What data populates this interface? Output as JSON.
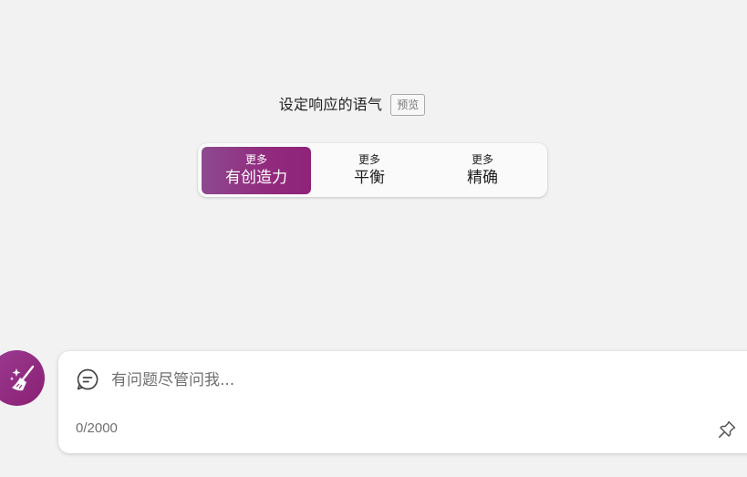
{
  "tone": {
    "title": "设定响应的语气",
    "preview_badge": "预览",
    "options": [
      {
        "small": "更多",
        "big": "有创造力",
        "active": true
      },
      {
        "small": "更多",
        "big": "平衡",
        "active": false
      },
      {
        "small": "更多",
        "big": "精确",
        "active": false
      }
    ]
  },
  "composer": {
    "placeholder": "有问题尽管问我...",
    "value": "",
    "char_count": "0/2000",
    "new_topic_icon": "broom-sparkle-icon",
    "chat_icon": "chat-bubble-icon",
    "pin_icon": "pin-icon"
  },
  "colors": {
    "accent_start": "#8d4a8f",
    "accent_end": "#8f2379",
    "background": "#f2f2f2"
  }
}
